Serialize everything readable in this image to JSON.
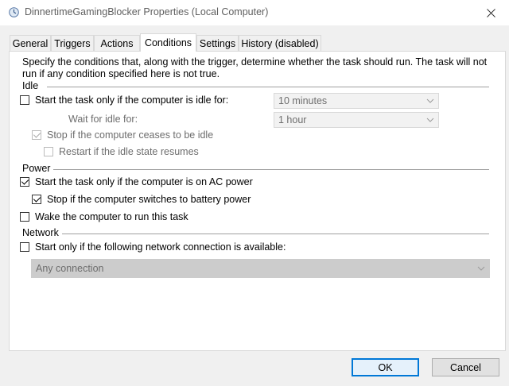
{
  "window": {
    "title": "DinnertimeGamingBlocker Properties (Local Computer)",
    "icon": "task-scheduler-icon",
    "close_icon": "close-icon"
  },
  "tabs": [
    {
      "label": "General",
      "active": false
    },
    {
      "label": "Triggers",
      "active": false
    },
    {
      "label": "Actions",
      "active": false
    },
    {
      "label": "Conditions",
      "active": true
    },
    {
      "label": "Settings",
      "active": false
    },
    {
      "label": "History (disabled)",
      "active": false
    }
  ],
  "conditions": {
    "description": "Specify the conditions that, along with the trigger, determine whether the task should run.  The task will not run  if any condition specified here is not true.",
    "idle": {
      "group_label": "Idle",
      "start_if_idle": {
        "label": "Start the task only if the computer is idle for:",
        "checked": false
      },
      "idle_for_value": "10 minutes",
      "wait_label": "Wait for idle for:",
      "wait_value": "1 hour",
      "stop_if_ceases": {
        "label": "Stop if the computer ceases to be idle",
        "checked": true,
        "disabled": true
      },
      "restart_if_resumes": {
        "label": "Restart if the idle state resumes",
        "checked": false,
        "disabled": true
      }
    },
    "power": {
      "group_label": "Power",
      "start_on_ac": {
        "label": "Start the task only if the computer is on AC power",
        "checked": true
      },
      "stop_on_battery": {
        "label": "Stop if the computer switches to battery power",
        "checked": true
      },
      "wake_to_run": {
        "label": "Wake the computer to run this task",
        "checked": false
      }
    },
    "network": {
      "group_label": "Network",
      "start_if_network": {
        "label": "Start only if the following network connection is available:",
        "checked": false
      },
      "connection_value": "Any connection"
    }
  },
  "buttons": {
    "ok_label": "OK",
    "cancel_label": "Cancel"
  }
}
